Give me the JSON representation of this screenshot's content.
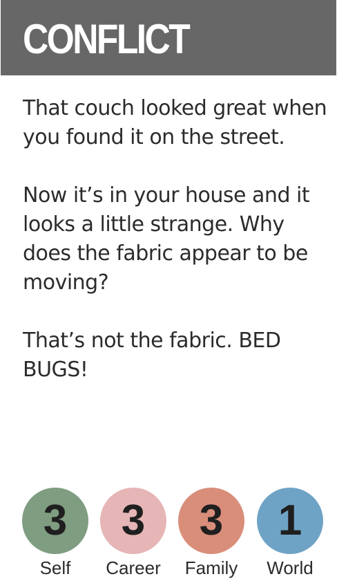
{
  "title": "CONFLICT",
  "paragraphs": [
    "That couch looked great when you found it on the street.",
    "Now it’s in your house and it looks a little strange. Why does the fabric appear to be moving?",
    "That’s not the fabric. BED BUGS!"
  ],
  "stats": [
    {
      "label": "Self",
      "value": "3",
      "color": "#7f9d81"
    },
    {
      "label": "Career",
      "value": "3",
      "color": "#e6b5b6"
    },
    {
      "label": "Family",
      "value": "3",
      "color": "#d98e7a"
    },
    {
      "label": "World",
      "value": "1",
      "color": "#6ea3c5"
    }
  ],
  "colors": {
    "header": "#676767",
    "text": "#2b2b2b"
  }
}
